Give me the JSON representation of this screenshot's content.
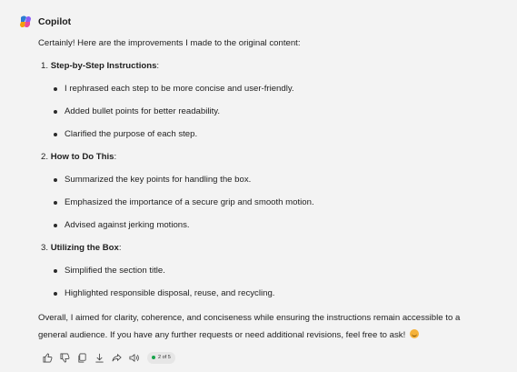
{
  "header": {
    "sender": "Copilot"
  },
  "message": {
    "intro": "Certainly! Here are the improvements I made to the original content:",
    "sections": [
      {
        "number": "1.",
        "title": "Step-by-Step Instructions",
        "suffix": ":",
        "items": [
          "I rephrased each step to be more concise and user-friendly.",
          "Added bullet points for better readability.",
          "Clarified the purpose of each step."
        ]
      },
      {
        "number": "2.",
        "title": "How to Do This",
        "suffix": ":",
        "items": [
          "Summarized the key points for handling the box.",
          "Emphasized the importance of a secure grip and smooth motion.",
          "Advised against jerking motions."
        ]
      },
      {
        "number": "3.",
        "title": "Utilizing the Box",
        "suffix": ":",
        "items": [
          "Simplified the section title.",
          "Highlighted responsible disposal, reuse, and recycling."
        ]
      }
    ],
    "outro_line1": "Overall, I aimed for clarity, coherence, and conciseness while ensuring the instructions remain accessible to a",
    "outro_line2": "general audience. If you have any further requests or need additional revisions, feel free to ask!"
  },
  "toolbar": {
    "icons": [
      "thumbs-up-icon",
      "thumbs-down-icon",
      "copy-icon",
      "download-icon",
      "share-icon",
      "speaker-icon"
    ],
    "pager": "2 of 5"
  },
  "colors": {
    "background": "#f3f3f3",
    "text": "#1f1f1f",
    "pager_dot": "#17a34a"
  }
}
